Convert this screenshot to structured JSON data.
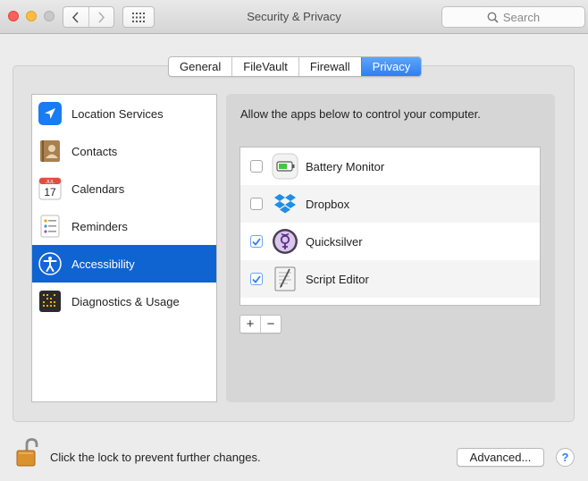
{
  "window": {
    "title": "Security & Privacy",
    "search_placeholder": "Search"
  },
  "tabs": [
    {
      "label": "General",
      "active": false
    },
    {
      "label": "FileVault",
      "active": false
    },
    {
      "label": "Firewall",
      "active": false
    },
    {
      "label": "Privacy",
      "active": true
    }
  ],
  "sidebar": {
    "items": [
      {
        "label": "Location Services",
        "icon": "location-arrow-icon",
        "selected": false
      },
      {
        "label": "Contacts",
        "icon": "contacts-book-icon",
        "selected": false
      },
      {
        "label": "Calendars",
        "icon": "calendar-icon",
        "selected": false,
        "icon_month": "JUL",
        "icon_day": "17"
      },
      {
        "label": "Reminders",
        "icon": "reminders-list-icon",
        "selected": false
      },
      {
        "label": "Accessibility",
        "icon": "accessibility-person-icon",
        "selected": true
      },
      {
        "label": "Diagnostics & Usage",
        "icon": "diagnostics-grid-icon",
        "selected": false
      }
    ]
  },
  "main": {
    "instruction": "Allow the apps below to control your computer.",
    "apps": [
      {
        "name": "Battery Monitor",
        "checked": false,
        "icon": "battery-icon"
      },
      {
        "name": "Dropbox",
        "checked": false,
        "icon": "dropbox-icon"
      },
      {
        "name": "Quicksilver",
        "checked": true,
        "icon": "quicksilver-icon"
      },
      {
        "name": "Script Editor",
        "checked": true,
        "icon": "script-editor-icon"
      }
    ],
    "add_label": "+",
    "remove_label": "−"
  },
  "footer": {
    "lock_text": "Click the lock to prevent further changes.",
    "advanced_label": "Advanced...",
    "help_label": "?"
  },
  "colors": {
    "accent": "#0f64d2",
    "tab_active": "#3d8bf5",
    "checkbox_checked": "#2f7ef0"
  }
}
